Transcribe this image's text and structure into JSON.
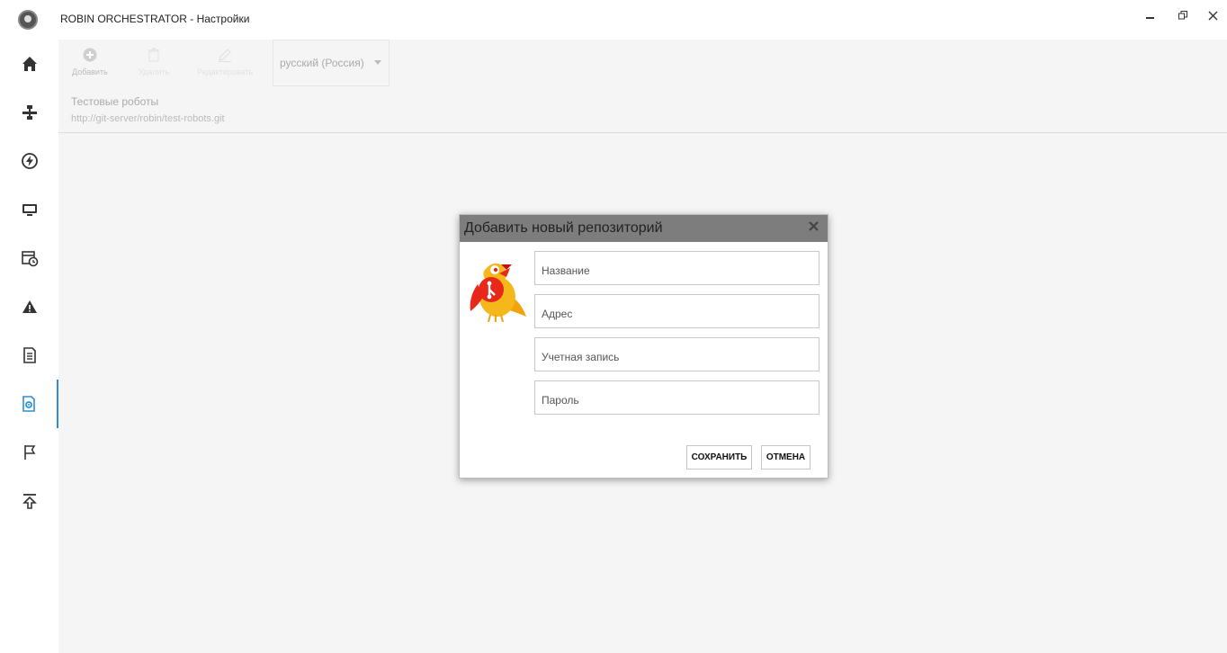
{
  "window": {
    "title": "ROBIN ORCHESTRATOR - Настройки",
    "controls": [
      "minimize-icon",
      "restore-icon",
      "close-icon"
    ]
  },
  "sidebar": {
    "items": [
      {
        "icon": "home-icon"
      },
      {
        "icon": "network-icon"
      },
      {
        "icon": "lightning-icon"
      },
      {
        "icon": "monitor-icon"
      },
      {
        "icon": "schedule-icon"
      },
      {
        "icon": "warning-icon"
      },
      {
        "icon": "log-icon"
      },
      {
        "icon": "settings-icon",
        "active": true
      },
      {
        "icon": "flag-icon"
      },
      {
        "icon": "upload-icon"
      }
    ],
    "active_color": "#2b8fd6"
  },
  "toolbar": {
    "add_label": "Добавить",
    "delete_label": "Удалить",
    "edit_label": "Редактировать",
    "language": "русский (Россия)"
  },
  "repository": {
    "name": "Тестовые роботы",
    "url": "http://git-server/robin/test-robots.git"
  },
  "dialog": {
    "title": "Добавить новый репозиторий",
    "fields": {
      "name": {
        "placeholder": "Название",
        "value": ""
      },
      "address": {
        "placeholder": "Адрес",
        "value": ""
      },
      "account": {
        "placeholder": "Учетная запись",
        "value": ""
      },
      "password": {
        "placeholder": "Пароль",
        "value": ""
      }
    },
    "save_label": "СОХРАНИТЬ",
    "cancel_label": "ОТМЕНА"
  }
}
